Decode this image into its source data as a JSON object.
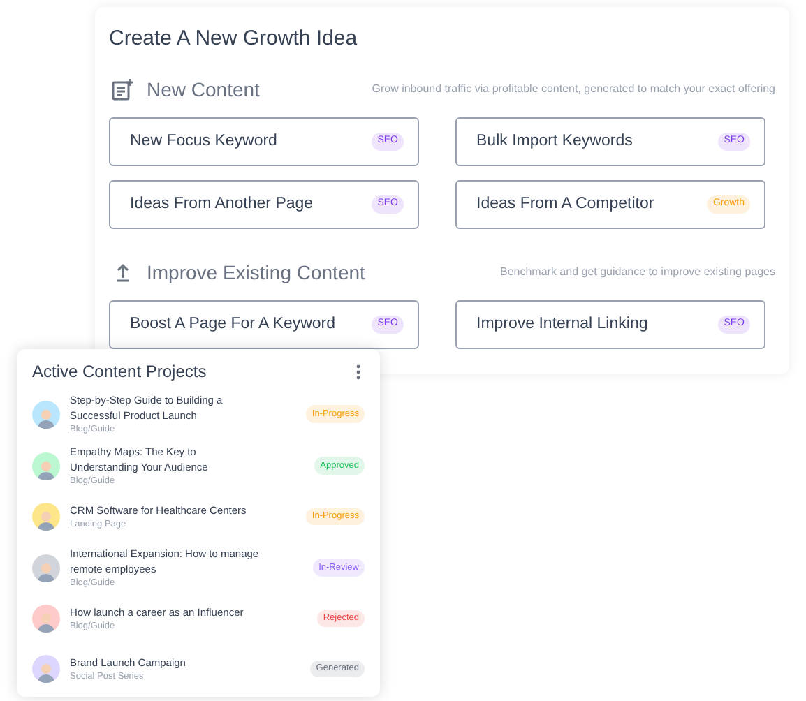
{
  "growth_panel": {
    "title": "Create A New Growth Idea",
    "sections": [
      {
        "kind": "new",
        "title": "New Content",
        "description": "Grow inbound traffic via profitable content, generated to match your exact offering",
        "options": [
          {
            "label": "New Focus Keyword",
            "tag": {
              "label": "SEO",
              "color": "#7c3aed"
            }
          },
          {
            "label": "Bulk Import Keywords",
            "tag": {
              "label": "SEO",
              "color": "#7c3aed"
            }
          },
          {
            "label": "Ideas From Another Page",
            "tag": {
              "label": "SEO",
              "color": "#7c3aed"
            }
          },
          {
            "label": "Ideas From A Competitor",
            "tag": {
              "label": "Growth",
              "color": "#f59e0b"
            }
          }
        ]
      },
      {
        "kind": "improve",
        "title": "Improve Existing Content",
        "description": "Benchmark and get guidance to improve existing pages",
        "options": [
          {
            "label": "Boost A Page For A Keyword",
            "tag": {
              "label": "SEO",
              "color": "#7c3aed"
            }
          },
          {
            "label": "Improve Internal Linking",
            "tag": {
              "label": "SEO",
              "color": "#7c3aed"
            }
          }
        ]
      }
    ]
  },
  "projects_card": {
    "title": "Active Content Projects",
    "projects": [
      {
        "title": "Step-by-Step Guide to Building a Successful Product Launch",
        "type": "Blog/Guide",
        "avatar": {
          "color": "#bae6fd"
        },
        "status": {
          "label": "In-Progress",
          "color": "#f59e0b"
        }
      },
      {
        "title": "Empathy Maps: The Key to Understanding Your Audience",
        "type": "Blog/Guide",
        "avatar": {
          "color": "#bbf7d0"
        },
        "status": {
          "label": "Approved",
          "color": "#22c55e"
        }
      },
      {
        "title": "CRM Software for Healthcare Centers",
        "type": "Landing Page",
        "avatar": {
          "color": "#fde68a"
        },
        "status": {
          "label": "In-Progress",
          "color": "#f59e0b"
        }
      },
      {
        "title": "International Expansion: How to manage remote employees",
        "type": "Blog/Guide",
        "avatar": {
          "color": "#d1d5db"
        },
        "status": {
          "label": "In-Review",
          "color": "#8b5cf6"
        }
      },
      {
        "title": "How launch a career as an Influencer",
        "type": "Blog/Guide",
        "avatar": {
          "color": "#fecaca"
        },
        "status": {
          "label": "Rejected",
          "color": "#ef4444"
        }
      },
      {
        "title": "Brand Launch Campaign",
        "type": "Social Post Series",
        "avatar": {
          "color": "#ddd6fe"
        },
        "status": {
          "label": "Generated",
          "color": "#6b7280"
        }
      }
    ]
  }
}
